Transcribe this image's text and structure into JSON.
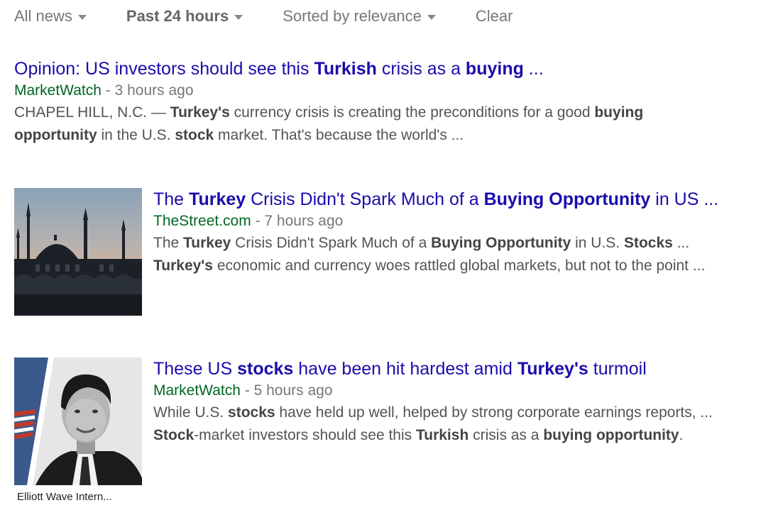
{
  "toolbar": {
    "news_filter": "All news",
    "time_filter": "Past 24 hours",
    "sort_filter": "Sorted by relevance",
    "clear": "Clear"
  },
  "results": [
    {
      "title": [
        {
          "t": "Opinion: US investors should see this "
        },
        {
          "t": "Turkish",
          "b": true
        },
        {
          "t": " crisis as a "
        },
        {
          "t": "buying",
          "b": true
        },
        {
          "t": " ..."
        }
      ],
      "source": "MarketWatch",
      "time": " - 3 hours ago",
      "snippet_lines": [
        [
          {
            "t": "CHAPEL HILL, N.C. — "
          },
          {
            "t": "Turkey's",
            "b": true
          },
          {
            "t": " currency crisis is creating the preconditions for a good "
          },
          {
            "t": "buying",
            "b": true
          }
        ],
        [
          {
            "t": "opportunity",
            "b": true
          },
          {
            "t": " in the U.S. "
          },
          {
            "t": "stock",
            "b": true
          },
          {
            "t": " market. That's because the world's ..."
          }
        ]
      ]
    },
    {
      "title": [
        {
          "t": "The "
        },
        {
          "t": "Turkey",
          "b": true
        },
        {
          "t": " Crisis Didn't Spark Much of a "
        },
        {
          "t": "Buying Opportunity",
          "b": true
        },
        {
          "t": " in US ..."
        }
      ],
      "source": "TheStreet.com",
      "time": " - 7 hours ago",
      "thumbnail": "mosque-silhouette-sunset",
      "snippet_lines": [
        [
          {
            "t": "The "
          },
          {
            "t": "Turkey",
            "b": true
          },
          {
            "t": " Crisis Didn't Spark Much of a "
          },
          {
            "t": "Buying Opportunity",
            "b": true
          },
          {
            "t": " in U.S. "
          },
          {
            "t": "Stocks",
            "b": true
          },
          {
            "t": " ..."
          }
        ],
        [
          {
            "t": "Turkey's",
            "b": true
          },
          {
            "t": " economic and currency woes rattled global markets, but not to the point ..."
          }
        ]
      ]
    },
    {
      "title": [
        {
          "t": "These US "
        },
        {
          "t": "stocks",
          "b": true
        },
        {
          "t": " have been hit hardest amid "
        },
        {
          "t": "Turkey's",
          "b": true
        },
        {
          "t": " turmoil"
        }
      ],
      "source": "MarketWatch",
      "time": " - 5 hours ago",
      "thumbnail": "man-portrait-bw",
      "thumbnail_caption": "Elliott Wave Intern...",
      "snippet_lines": [
        [
          {
            "t": "While U.S. "
          },
          {
            "t": "stocks",
            "b": true
          },
          {
            "t": " have held up well, helped by strong corporate earnings reports, ..."
          }
        ],
        [
          {
            "t": "Stock",
            "b": true
          },
          {
            "t": "-market investors should see this "
          },
          {
            "t": "Turkish",
            "b": true
          },
          {
            "t": " crisis as a "
          },
          {
            "t": "buying opportunity",
            "b": true
          },
          {
            "t": "."
          }
        ]
      ]
    }
  ]
}
